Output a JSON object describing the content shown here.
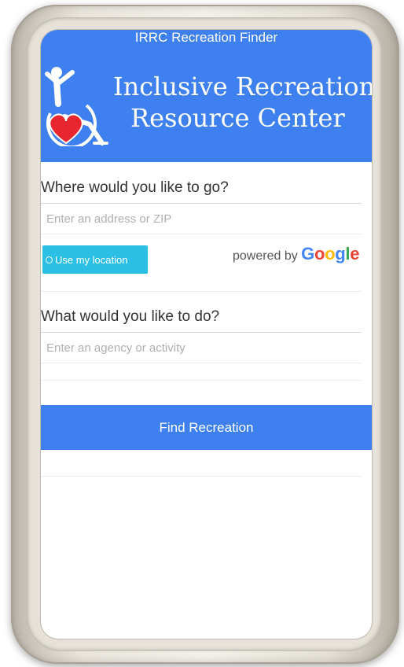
{
  "app": {
    "title": "IRRC Recreation Finder"
  },
  "header": {
    "org_line_1": "Inclusive Recreation",
    "org_line_2": "Resource Center",
    "logo_icon": "wheelchair-heart-logo",
    "background_color": "#3e80ef"
  },
  "location": {
    "label": "Where would you like to go?",
    "placeholder": "Enter an address or ZIP",
    "value": "",
    "use_location_label": "Use my location",
    "use_location_icon": "circle-icon",
    "use_location_color": "#2bbfe6"
  },
  "powered_by": {
    "text": "powered by",
    "letters": [
      {
        "char": "G",
        "color": "#4285f4"
      },
      {
        "char": "o",
        "color": "#ea4335"
      },
      {
        "char": "o",
        "color": "#fbbc05"
      },
      {
        "char": "g",
        "color": "#4285f4"
      },
      {
        "char": "l",
        "color": "#34a853"
      },
      {
        "char": "e",
        "color": "#ea4335"
      }
    ]
  },
  "activity": {
    "label": "What would you like to do?",
    "placeholder": "Enter an agency or activity",
    "value": ""
  },
  "actions": {
    "find_label": "Find Recreation",
    "find_color": "#3e80ef"
  }
}
